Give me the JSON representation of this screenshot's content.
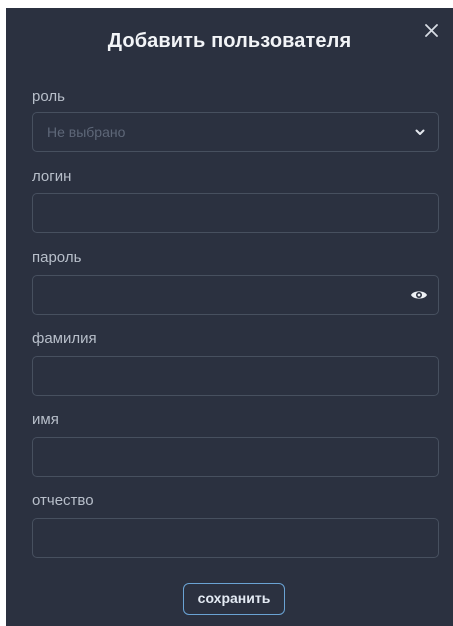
{
  "dialog": {
    "title": "Добавить пользователя",
    "close_icon": "close-icon"
  },
  "fields": {
    "role": {
      "label": "роль",
      "selected": "Не выбрано",
      "icon": "chevron-down-icon"
    },
    "login": {
      "label": "логин",
      "value": ""
    },
    "password": {
      "label": "пароль",
      "value": "",
      "icon": "eye-icon"
    },
    "lastname": {
      "label": "фамилия",
      "value": ""
    },
    "firstname": {
      "label": "имя",
      "value": ""
    },
    "patronymic": {
      "label": "отчество",
      "value": ""
    }
  },
  "actions": {
    "save_label": "сохранить"
  },
  "colors": {
    "background": "#2b3140",
    "border": "#47505f",
    "accent": "#6aa3d4",
    "title": "#f2f4f7"
  }
}
